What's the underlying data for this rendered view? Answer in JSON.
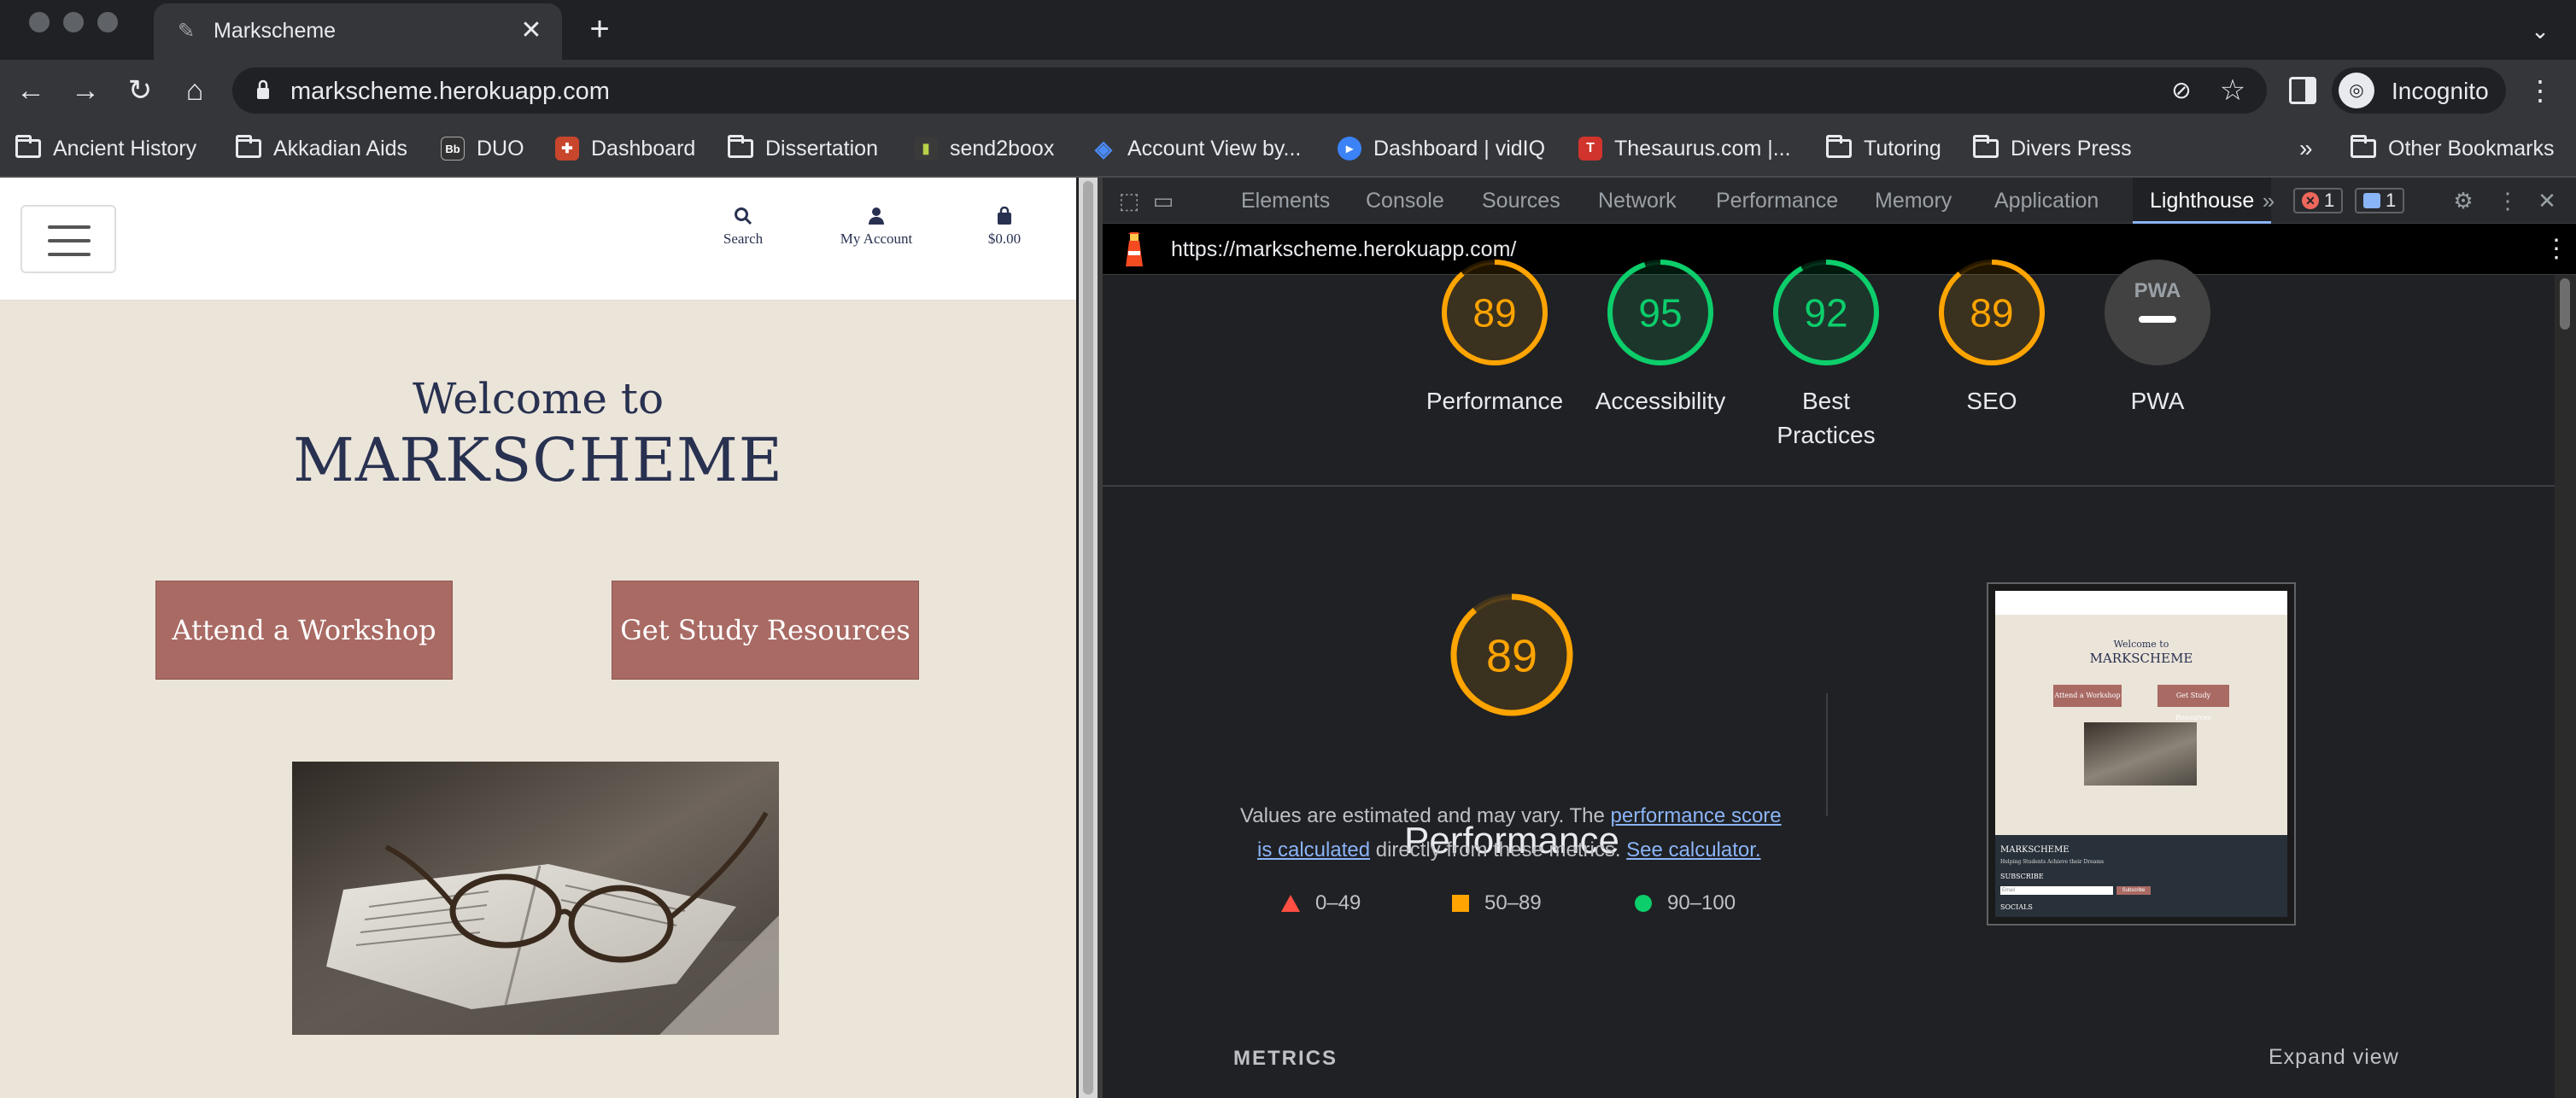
{
  "browser": {
    "tab_title": "Markscheme",
    "new_tab_label": "+",
    "address": "markscheme.herokuapp.com",
    "profile_label": "Incognito",
    "bookmarks": [
      {
        "label": "Ancient History",
        "icon": "folder-icon"
      },
      {
        "label": "Akkadian Aids",
        "icon": "folder-icon"
      },
      {
        "label": "DUO",
        "icon": "blackboard-favicon"
      },
      {
        "label": "Dashboard",
        "icon": "dashboard-favicon"
      },
      {
        "label": "Dissertation",
        "icon": "folder-icon"
      },
      {
        "label": "send2boox",
        "icon": "send2boox-favicon"
      },
      {
        "label": "Account View by...",
        "icon": "account-favicon"
      },
      {
        "label": "Dashboard | vidIQ",
        "icon": "vidiq-favicon"
      },
      {
        "label": "Thesaurus.com |...",
        "icon": "thesaurus-favicon"
      },
      {
        "label": "Tutoring",
        "icon": "folder-icon"
      },
      {
        "label": "Divers Press",
        "icon": "folder-icon"
      }
    ],
    "bookmarks_overflow": "»",
    "other_bookmarks": "Other Bookmarks"
  },
  "site": {
    "header": {
      "search_label": "Search",
      "account_label": "My Account",
      "cart_label": "$0.00"
    },
    "welcome": "Welcome to",
    "brand": "MARKSCHEME",
    "buttons": {
      "workshop": "Attend a Workshop",
      "resources": "Get Study Resources"
    }
  },
  "devtools": {
    "tabs": [
      "Elements",
      "Console",
      "Sources",
      "Network",
      "Performance",
      "Memory",
      "Application",
      "Lighthouse"
    ],
    "active_tab": "Lighthouse",
    "error_count": "1",
    "message_count": "1",
    "report_url": "https://markscheme.herokuapp.com/",
    "scores": [
      {
        "label": "Performance",
        "score": "89",
        "value": 89,
        "color": "#ffa400"
      },
      {
        "label": "Accessibility",
        "score": "95",
        "value": 95,
        "color": "#0cce6b"
      },
      {
        "label": "Best",
        "label2": "Practices",
        "score": "92",
        "value": 92,
        "color": "#0cce6b"
      },
      {
        "label": "SEO",
        "score": "89",
        "value": 89,
        "color": "#ffa400"
      },
      {
        "label": "PWA",
        "score": "PWA",
        "color": "#9aa0a6"
      }
    ],
    "perf_section": {
      "score": "89",
      "value": 89,
      "title": "Performance",
      "note_prefix": "Values are estimated and may vary. The ",
      "note_link1a": "performance score",
      "note_link1b": "is calculated",
      "note_mid": " directly from these metrics. ",
      "note_link2": "See calculator.",
      "legend": [
        {
          "range": "0–49",
          "color": "#ff4e42",
          "shape": "triangle"
        },
        {
          "range": "50–89",
          "color": "#ffa400",
          "shape": "square"
        },
        {
          "range": "90–100",
          "color": "#0cce6b",
          "shape": "circle"
        }
      ]
    },
    "thumbnail": {
      "welcome": "Welcome to",
      "brand": "MARKSCHEME",
      "btn1": "Attend a Workshop",
      "btn2": "Get Study Resources",
      "footer_brand": "MARKSCHEME",
      "footer_tagline": "Helping Students Achieve their Dreams",
      "subscribe_heading": "SUBSCRIBE",
      "email_placeholder": "Email",
      "subscribe_btn": "Subscribe",
      "socials": "SOCIALS"
    },
    "metrics_heading": "METRICS",
    "expand_view": "Expand view"
  }
}
